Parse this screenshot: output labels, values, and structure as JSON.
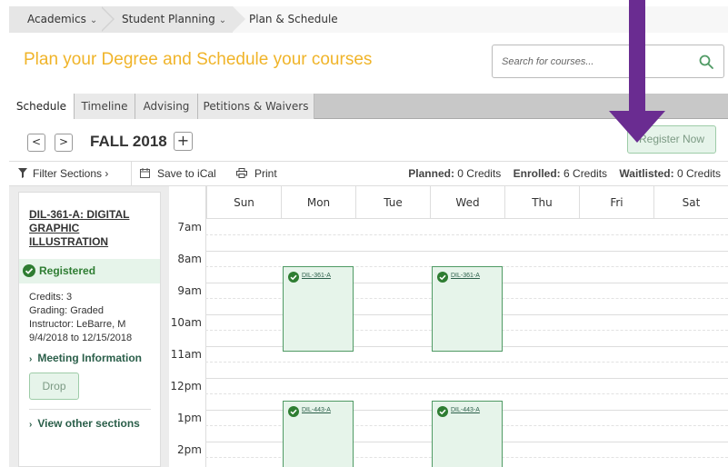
{
  "breadcrumb": {
    "items": [
      {
        "label": "Academics"
      },
      {
        "label": "Student Planning"
      },
      {
        "label": "Plan & Schedule"
      }
    ]
  },
  "page": {
    "title": "Plan your Degree and Schedule your courses"
  },
  "search": {
    "placeholder": "Search for courses..."
  },
  "tabs": [
    {
      "label": "Schedule",
      "active": true
    },
    {
      "label": "Timeline"
    },
    {
      "label": "Advising"
    },
    {
      "label": "Petitions & Waivers"
    }
  ],
  "term": {
    "prev_label": "<",
    "next_label": ">",
    "name": "FALL 2018",
    "add_label": "+",
    "register_label": "Register Now"
  },
  "tools": {
    "filter_label": "Filter Sections ›",
    "ical_label": "Save to iCal",
    "print_label": "Print"
  },
  "credits": {
    "planned_label": "Planned:",
    "planned_value": "0 Credits",
    "enrolled_label": "Enrolled:",
    "enrolled_value": "6 Credits",
    "waitlisted_label": "Waitlisted:",
    "waitlisted_value": "0 Credits"
  },
  "course": {
    "title": "DIL-361-A: DIGITAL GRAPHIC ILLUSTRATION",
    "status": "Registered",
    "credits": "Credits: 3",
    "grading": "Grading: Graded",
    "instructor": "Instructor: LeBarre, M",
    "dates": "9/4/2018 to 12/15/2018",
    "meeting_link": "Meeting Information",
    "drop_label": "Drop",
    "other_sections_link": "View other sections"
  },
  "calendar": {
    "days": [
      "Sun",
      "Mon",
      "Tue",
      "Wed",
      "Thu",
      "Fri",
      "Sat"
    ],
    "times": [
      "7am",
      "8am",
      "9am",
      "10am",
      "11am",
      "12pm",
      "1pm",
      "2pm"
    ],
    "events": [
      {
        "label": "DIL-361-A",
        "day": "Mon"
      },
      {
        "label": "DIL-361-A",
        "day": "Wed"
      },
      {
        "label": "DIL-443-A",
        "day": "Mon"
      },
      {
        "label": "DIL-443-A",
        "day": "Wed"
      }
    ]
  },
  "colors": {
    "title": "#f0b429",
    "registered_green": "#2e7d32",
    "event_fill": "#e6f4ea",
    "event_border": "#4f9a64",
    "arrow_purple": "#6a2c91"
  }
}
